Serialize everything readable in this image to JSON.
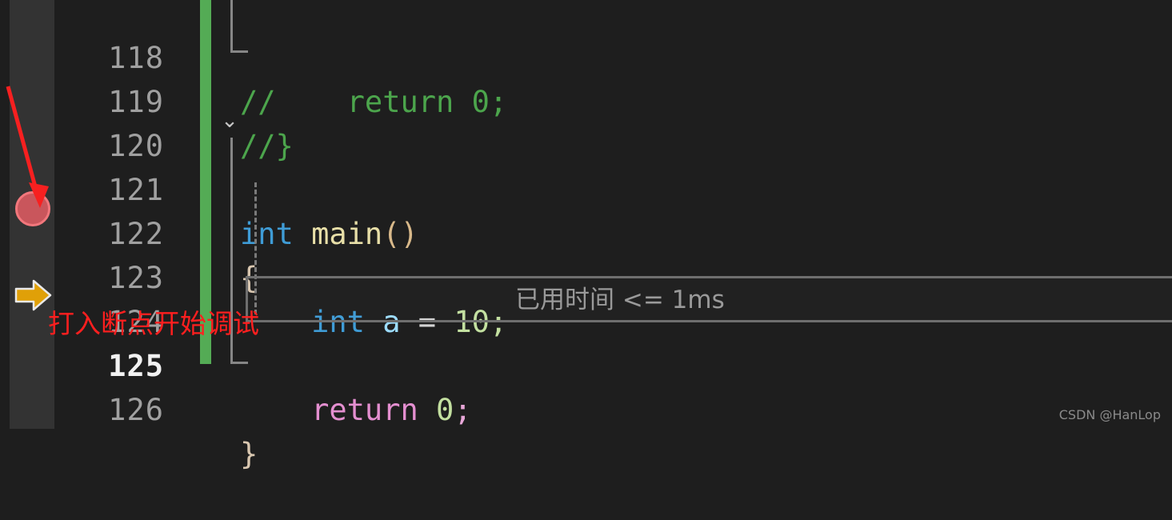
{
  "app": {
    "kind": "code-editor-debug-view",
    "theme": "dark",
    "background": "#1e1e1e",
    "gutter_background": "#333333"
  },
  "editor": {
    "lines": [
      {
        "number": "118",
        "text": "//    return 0;",
        "clipped": true,
        "tokens": [
          {
            "text": "//    return 0;",
            "type": "comment"
          }
        ]
      },
      {
        "number": "119",
        "text": "//}",
        "tokens": [
          {
            "text": "//}",
            "type": "comment"
          }
        ]
      },
      {
        "number": "120",
        "text": "",
        "tokens": []
      },
      {
        "number": "121",
        "text": "int main()",
        "tokens": [
          {
            "text": "int",
            "type": "type"
          },
          {
            "text": " ",
            "type": "plain"
          },
          {
            "text": "main",
            "type": "func"
          },
          {
            "text": "()",
            "type": "paren"
          }
        ]
      },
      {
        "number": "122",
        "text": "{",
        "tokens": [
          {
            "text": "{",
            "type": "brace"
          }
        ]
      },
      {
        "number": "123",
        "text": "    int a = 10;",
        "tokens": [
          {
            "text": "    ",
            "type": "plain"
          },
          {
            "text": "int",
            "type": "type"
          },
          {
            "text": " ",
            "type": "plain"
          },
          {
            "text": "a",
            "type": "var"
          },
          {
            "text": " ",
            "type": "plain"
          },
          {
            "text": "=",
            "type": "op"
          },
          {
            "text": " ",
            "type": "plain"
          },
          {
            "text": "10",
            "type": "num"
          },
          {
            "text": ";",
            "type": "semi"
          }
        ]
      },
      {
        "number": "124",
        "text": "",
        "tokens": []
      },
      {
        "number": "125",
        "text": "    return 0;",
        "current": true,
        "tokens": [
          {
            "text": "    ",
            "type": "plain"
          },
          {
            "text": "return",
            "type": "kw"
          },
          {
            "text": " ",
            "type": "plain"
          },
          {
            "text": "0",
            "type": "num"
          },
          {
            "text": ";",
            "type": "semi-pk"
          }
        ]
      },
      {
        "number": "126",
        "text": "}",
        "tokens": [
          {
            "text": "}",
            "type": "brace"
          }
        ]
      }
    ]
  },
  "inline_hint": {
    "label": "已用时间 <= 1ms",
    "color": "#9a9a9a"
  },
  "gutter": {
    "breakpoint": {
      "icon": "breakpoint-dot",
      "line": "123",
      "fill": "#c9565c",
      "border": "#f2777c"
    },
    "execution_pointer": {
      "icon": "execution-arrow",
      "line": "125",
      "fill": "#e0a008",
      "border": "#e8e8e8"
    },
    "change_bar": {
      "color": "#54ab55",
      "lines": "118-126"
    },
    "fold_chevron": {
      "icon": "chevron-down-icon",
      "line": "121",
      "glyph": "⌄"
    }
  },
  "annotation": {
    "text": "打入断点开始调试",
    "color": "#ff1f1f",
    "arrow_color": "#f72020",
    "arrow_target": "breakpoint-dot"
  },
  "watermark": {
    "text": "CSDN @HanLop"
  }
}
